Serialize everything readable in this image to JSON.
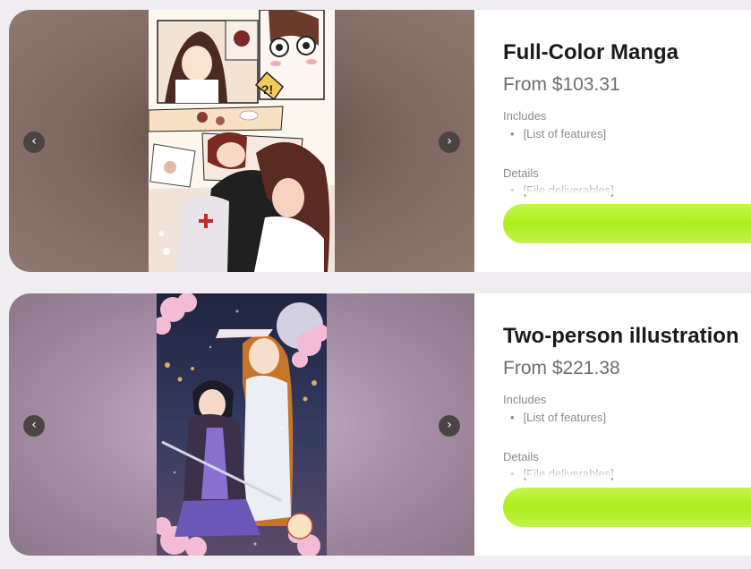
{
  "products": [
    {
      "title": "Full-Color Manga",
      "price": "From $103.31",
      "includes_label": "Includes",
      "includes_items": [
        "[List of features]"
      ],
      "details_label": "Details",
      "details_items": [
        "[File deliverables]"
      ],
      "prev_icon": "‹",
      "next_icon": "›"
    },
    {
      "title": "Two-person illustration",
      "price": "From $221.38",
      "includes_label": "Includes",
      "includes_items": [
        "[List of features]"
      ],
      "details_label": "Details",
      "details_items": [
        "[File deliverables]"
      ],
      "prev_icon": "‹",
      "next_icon": "›"
    }
  ],
  "colors": {
    "page_background": "#efedf0",
    "buy_button": "#b4f025",
    "card1_gallery_bg": "#7b645c",
    "card2_gallery_bg": "#a890a6"
  }
}
